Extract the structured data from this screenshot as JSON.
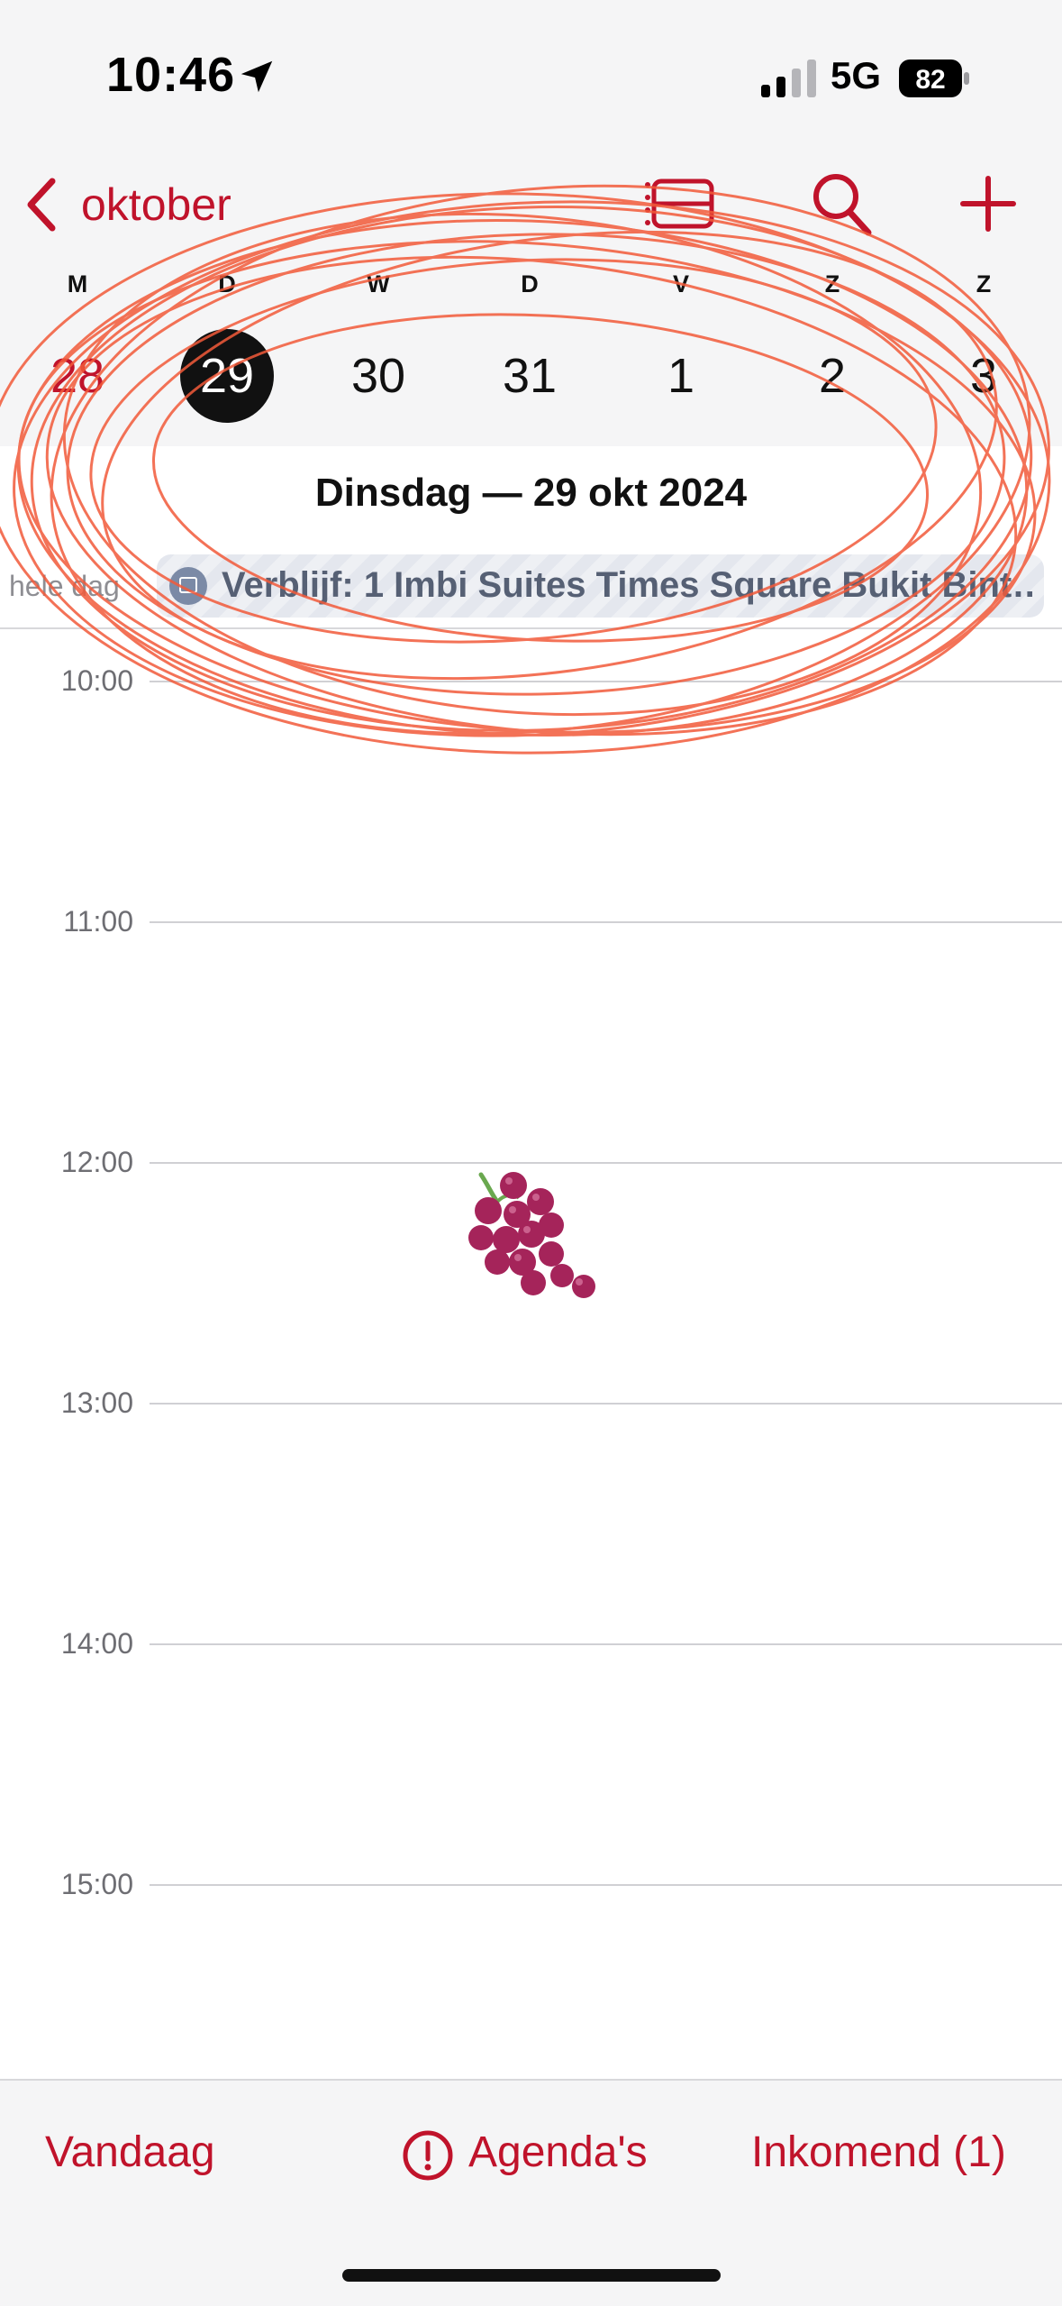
{
  "status_bar": {
    "time": "10:46",
    "network": "5G",
    "battery": "82"
  },
  "nav": {
    "month_label": "oktober"
  },
  "week": {
    "days": [
      {
        "weekday": "M",
        "date": "28"
      },
      {
        "weekday": "D",
        "date": "29"
      },
      {
        "weekday": "W",
        "date": "30"
      },
      {
        "weekday": "D",
        "date": "31"
      },
      {
        "weekday": "V",
        "date": "1"
      },
      {
        "weekday": "Z",
        "date": "2"
      },
      {
        "weekday": "Z",
        "date": "3"
      }
    ]
  },
  "day_title": "Dinsdag — 29 okt 2024",
  "all_day": {
    "label": "hele dag",
    "event": "Verblijf: 1 Imbi Suites Times Square Bukit Bint…"
  },
  "hours": [
    "10:00",
    "11:00",
    "12:00",
    "13:00",
    "14:00",
    "15:00"
  ],
  "event_emoji": "grapes",
  "bottom_bar": {
    "today": "Vandaag",
    "calendars": "Agenda's",
    "inbox": "Inkomend (1)"
  },
  "colors": {
    "accent": "#c0132b",
    "annotation": "#f25a3a"
  }
}
